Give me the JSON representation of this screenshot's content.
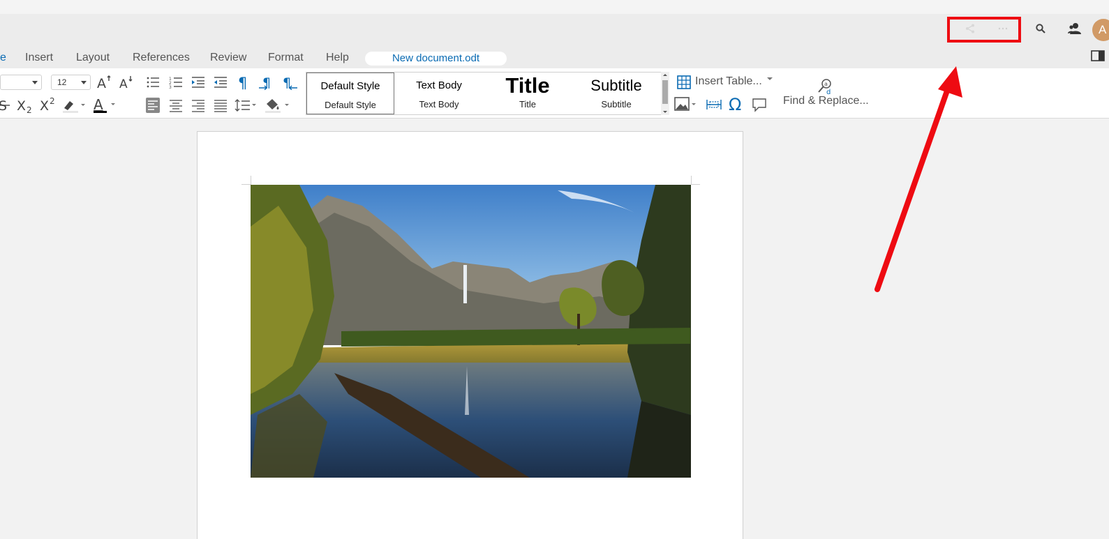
{
  "header": {
    "share_icon": "share-icon",
    "more_icon": "more-options-icon",
    "search_icon": "search-icon",
    "users_icon": "users-icon",
    "avatar_letter": "A"
  },
  "tabs": [
    "e",
    "Insert",
    "Layout",
    "References",
    "Review",
    "Format",
    "Help"
  ],
  "active_tab_index": 0,
  "document_name": "New document.odt",
  "toolbar": {
    "font_size": "12",
    "styles": [
      {
        "preview": "Default Style",
        "name": "Default Style"
      },
      {
        "preview": "Text Body",
        "name": "Text Body"
      },
      {
        "preview": "Title",
        "name": "Title"
      },
      {
        "preview": "Subtitle",
        "name": "Subtitle"
      }
    ],
    "insert_table_label": "Insert Table...",
    "find_replace_label": "Find & Replace..."
  },
  "colors": {
    "accent": "#0a6bb3",
    "annotation_red": "#ee0b12",
    "avatar_bg": "#d19a66"
  }
}
